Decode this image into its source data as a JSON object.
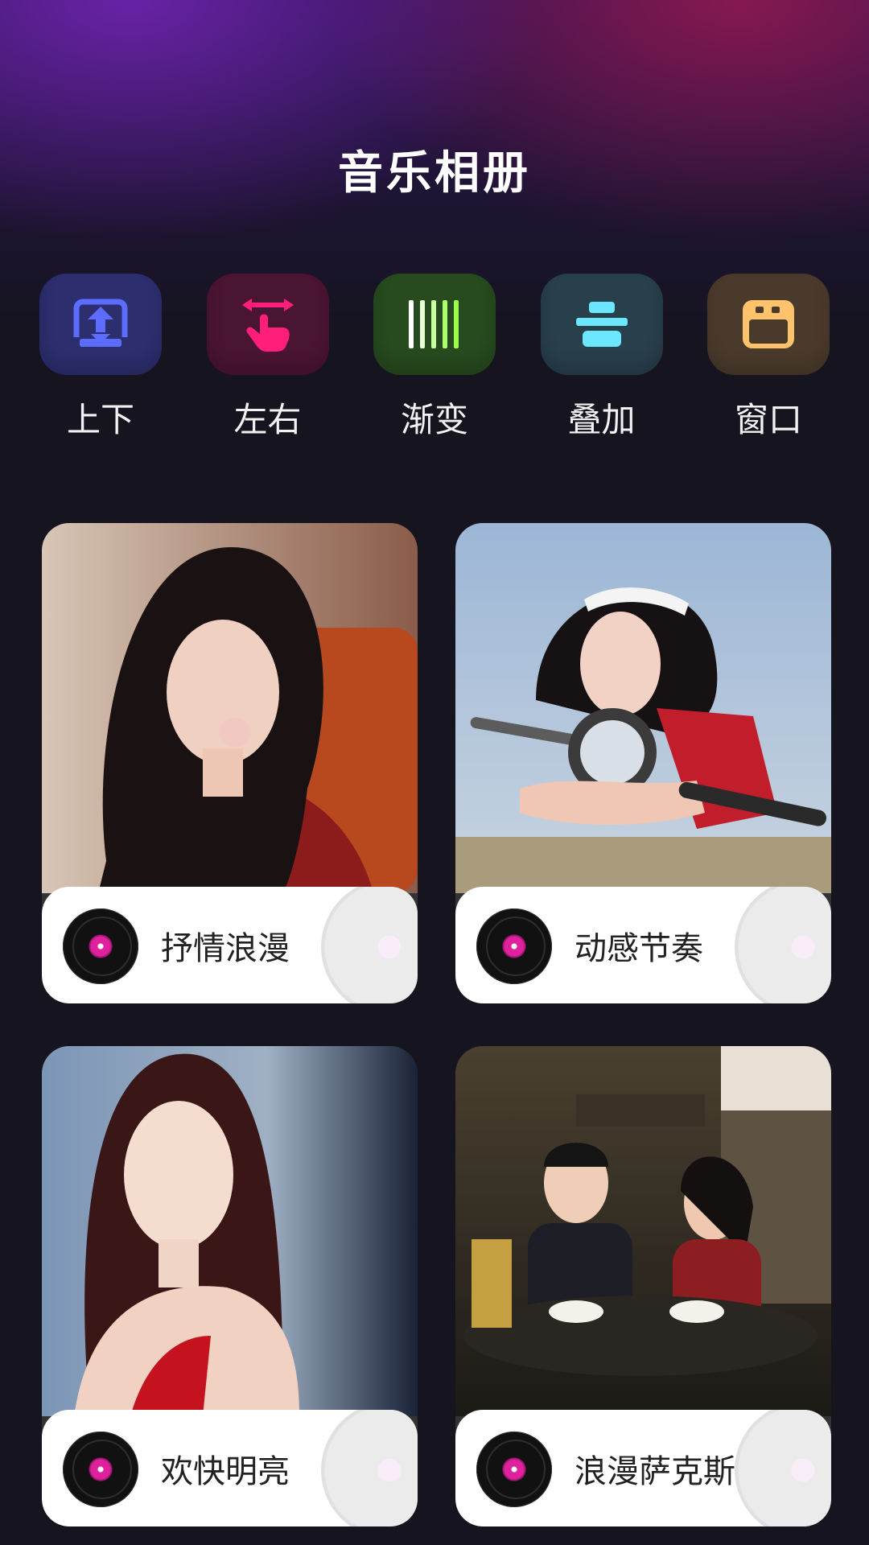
{
  "header": {
    "title": "音乐相册"
  },
  "modes": [
    {
      "label": "上下",
      "icon": "arrows-up-down-icon",
      "tile_color": "#2c2e6e",
      "icon_color": "#5b6cff"
    },
    {
      "label": "左右",
      "icon": "swipe-left-right-icon",
      "tile_color": "#4a1433",
      "icon_color": "#ff1f7a"
    },
    {
      "label": "渐变",
      "icon": "gradient-bars-icon",
      "tile_color": "#274a1f",
      "icon_color": "#9cff4a"
    },
    {
      "label": "叠加",
      "icon": "overlay-stack-icon",
      "tile_color": "#283f4c",
      "icon_color": "#6be8ff"
    },
    {
      "label": "窗口",
      "icon": "window-icon",
      "tile_color": "#4a3a2c",
      "icon_color": "#ffc46b"
    }
  ],
  "albums": [
    {
      "label": "抒情浪漫"
    },
    {
      "label": "动感节奏"
    },
    {
      "label": "欢快明亮"
    },
    {
      "label": "浪漫萨克斯"
    }
  ]
}
